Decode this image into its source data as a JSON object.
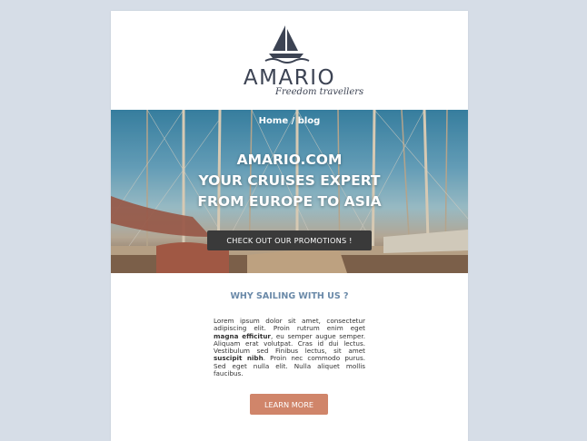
{
  "brand": {
    "name": "AMARIO",
    "tagline": "Freedom travellers"
  },
  "hero": {
    "breadcrumb": "Home / blog",
    "headline_lines": [
      "AMARIO.COM",
      "YOUR CRUISES EXPERT",
      "FROM EUROPE TO ASIA"
    ],
    "cta_label": "CHECK OUT OUR PROMOTIONS !"
  },
  "section": {
    "title": "WHY SAILING WITH US ?",
    "body": [
      {
        "text": "Lorem ipsum dolor sit amet, consectetur adipiscing elit. Proin rutrum enim eget ",
        "bold": false
      },
      {
        "text": "magna efficitur",
        "bold": true
      },
      {
        "text": ", eu semper augue semper. Aliquam erat volutpat. Cras id dui lectus. Vestibulum sed Finibus lectus, sit amet ",
        "bold": false
      },
      {
        "text": "suscipit nibh",
        "bold": true
      },
      {
        "text": ". Proin nec commodo purus. Sed eget nulla elit. Nulla aliquet mollis faucibus.",
        "bold": false
      }
    ],
    "button_label": "LEARN MORE"
  },
  "colors": {
    "page_bg": "#d6dde7",
    "card_bg": "#ffffff",
    "logo_navy": "#3c4353",
    "section_title": "#6a89a8",
    "cta_dark": "#3a3a3a",
    "accent_salmon": "#d0856a"
  },
  "icons": {
    "logo": "sailboat-icon"
  }
}
